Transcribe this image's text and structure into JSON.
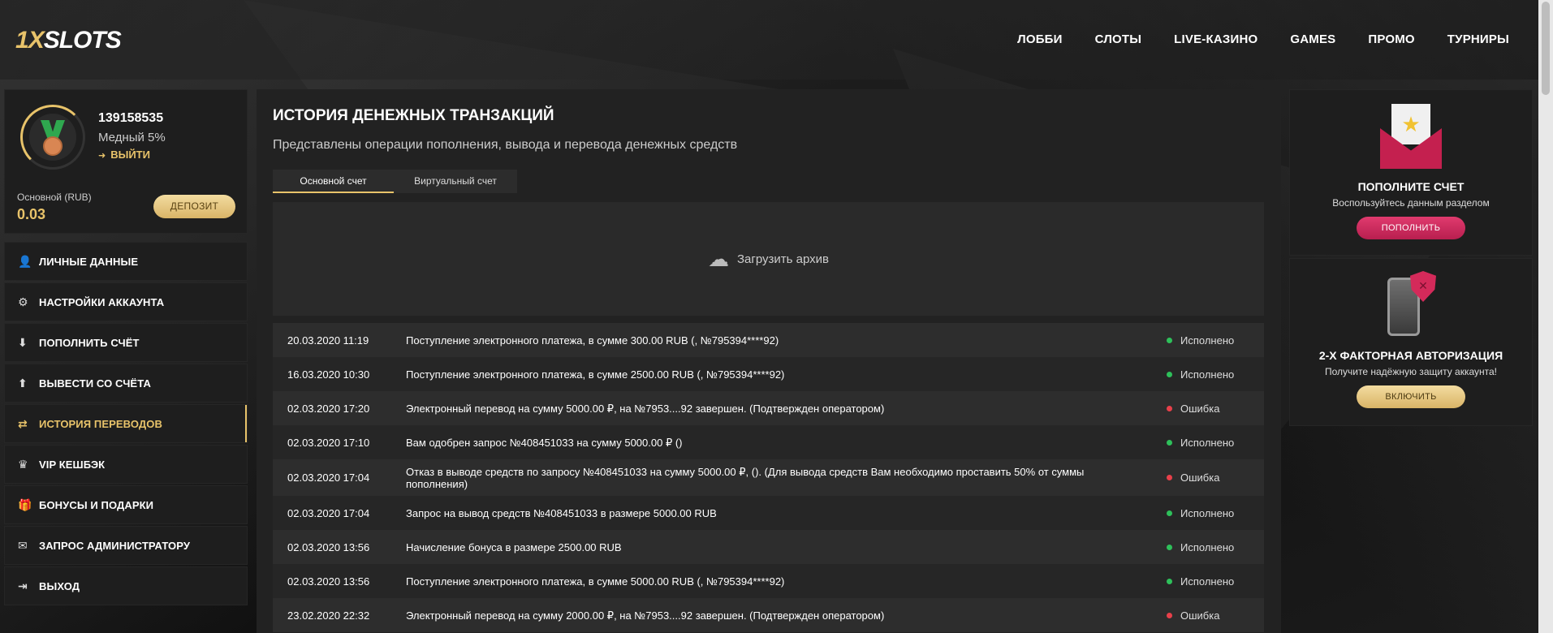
{
  "brand": {
    "logo_one": "1",
    "logo_x": "X",
    "logo_slots": "SLOTS"
  },
  "nav": [
    "ЛОББИ",
    "СЛОТЫ",
    "LIVE-КАЗИНО",
    "GAMES",
    "ПРОМО",
    "ТУРНИРЫ"
  ],
  "profile": {
    "user_id": "139158535",
    "level": "Медный 5%",
    "logout": "ВЫЙТИ",
    "balance_label": "Основной (RUB)",
    "balance_value": "0.03",
    "deposit_button": "ДЕПОЗИТ"
  },
  "menu": [
    {
      "label": "ЛИЧНЫЕ ДАННЫЕ",
      "icon": "user-plus-icon"
    },
    {
      "label": "НАСТРОЙКИ АККАУНТА",
      "icon": "gears-icon"
    },
    {
      "label": "ПОПОЛНИТЬ СЧЁТ",
      "icon": "download-icon"
    },
    {
      "label": "ВЫВЕСТИ СО СЧЁТА",
      "icon": "upload-icon"
    },
    {
      "label": "ИСТОРИЯ ПЕРЕВОДОВ",
      "icon": "transfer-arrows-icon",
      "active": true
    },
    {
      "label": "VIP КЕШБЭК",
      "icon": "crown-icon"
    },
    {
      "label": "БОНУСЫ И ПОДАРКИ",
      "icon": "gift-icon"
    },
    {
      "label": "ЗАПРОС АДМИНИСТРАТОРУ",
      "icon": "envelope-icon"
    },
    {
      "label": "ВЫХОД",
      "icon": "sign-out-icon"
    }
  ],
  "main": {
    "title": "ИСТОРИЯ ДЕНЕЖНЫХ ТРАНЗАКЦИЙ",
    "subtitle": "Представлены операции пополнения, вывода и перевода денежных средств",
    "tabs": [
      "Основной счет",
      "Виртуальный счет"
    ],
    "archive_label": "Загрузить архив",
    "transactions": [
      {
        "date": "20.03.2020 11:19",
        "desc": "Поступление электронного платежа, в сумме 300.00 RUB (, №795394****92)",
        "status": "Исполнено",
        "ok": true
      },
      {
        "date": "16.03.2020 10:30",
        "desc": "Поступление электронного платежа, в сумме 2500.00 RUB (, №795394****92)",
        "status": "Исполнено",
        "ok": true
      },
      {
        "date": "02.03.2020 17:20",
        "desc": "Электронный перевод на сумму 5000.00 ₽, на №7953....92 завершен. (Подтвержден оператором)",
        "status": "Ошибка",
        "ok": false
      },
      {
        "date": "02.03.2020 17:10",
        "desc": "Вам одобрен запрос №408451033 на сумму 5000.00 ₽ ()",
        "status": "Исполнено",
        "ok": true
      },
      {
        "date": "02.03.2020 17:04",
        "desc": "Отказ в выводе средств по запросу №408451033 на сумму 5000.00 ₽, (). (Для вывода средств Вам необходимо проставить 50% от суммы пополнения)",
        "status": "Ошибка",
        "ok": false
      },
      {
        "date": "02.03.2020 17:04",
        "desc": "Запрос на вывод средств №408451033 в размере 5000.00 RUB",
        "status": "Исполнено",
        "ok": true
      },
      {
        "date": "02.03.2020 13:56",
        "desc": "Начисление бонуса в размере 2500.00 RUB",
        "status": "Исполнено",
        "ok": true
      },
      {
        "date": "02.03.2020 13:56",
        "desc": "Поступление электронного платежа, в сумме 5000.00 RUB (, №795394****92)",
        "status": "Исполнено",
        "ok": true
      },
      {
        "date": "23.02.2020 22:32",
        "desc": "Электронный перевод на сумму 2000.00 ₽, на №7953....92 завершен. (Подтвержден оператором)",
        "status": "Ошибка",
        "ok": false
      }
    ]
  },
  "promo_deposit": {
    "title": "ПОПОЛНИТЕ СЧЕТ",
    "text": "Воспользуйтесь данным разделом",
    "button": "ПОПОЛНИТЬ"
  },
  "promo_2fa": {
    "title": "2-Х ФАКТОРНАЯ АВТОРИЗАЦИЯ",
    "text": "Получите надёжную защиту аккаунта!",
    "button": "ВКЛЮЧИТЬ"
  }
}
